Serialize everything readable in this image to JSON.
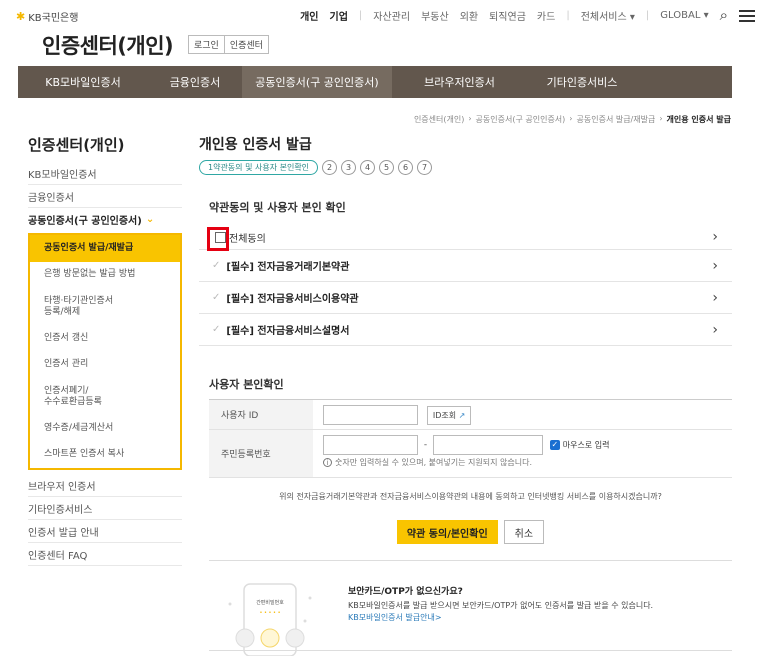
{
  "logo": {
    "mark": "✱",
    "text": "KB국민은행"
  },
  "topnav": {
    "items": [
      "개인",
      "기업",
      "자산관리",
      "부동산",
      "외환",
      "퇴직연금",
      "카드",
      "전체서비스 ▾",
      "GLOBAL ▾"
    ]
  },
  "title": "인증센터(개인)",
  "title_buttons": [
    "로그인",
    "인증센터"
  ],
  "gnb": [
    "KB모바일인증서",
    "금융인증서",
    "공동인증서(구 공인인증서)",
    "브라우저인증서",
    "기타인증서비스"
  ],
  "breadcrumb": [
    "인증센터(개인)",
    "공동인증서(구 공인인증서)",
    "공동인증서 발급/재발급",
    "개인용 인증서 발급"
  ],
  "sidebar": {
    "title": "인증센터(개인)",
    "top_items": [
      "KB모바일인증서",
      "금융인증서",
      "공동인증서(구 공인인증서)"
    ],
    "sub_items": [
      "공동인증서 발급/재발급",
      "은행 방문없는 발급 방법",
      "타행·타기관인증서\n등록/해제",
      "인증서 갱신",
      "인증서 관리",
      "인증서폐기/\n수수료환급등록",
      "영수증/세금계산서",
      "스마트폰 인증서 복사"
    ],
    "bottom_items": [
      "브라우저 인증서",
      "기타인증서비스",
      "인증서 발급 안내",
      "인증센터 FAQ"
    ]
  },
  "main": {
    "title": "개인용 인증서 발급",
    "step1": "1약관동의 및 사용자 본인확인",
    "steps": [
      "2",
      "3",
      "4",
      "5",
      "6",
      "7"
    ],
    "section1": "약관동의 및 사용자 본인 확인",
    "agree_all": "전체동의",
    "terms": [
      "[필수] 전자금융거래기본약관",
      "[필수] 전자금융서비스이용약관",
      "[필수] 전자금융서비스설명서"
    ],
    "section2": "사용자 본인확인",
    "user_id_label": "사용자 ID",
    "id_check_btn": "ID조회",
    "rrn_label": "주민등록번호",
    "rrn_sep": "-",
    "mouse_input": "마우스로 입력",
    "rrn_note": "숫자만 입력하실 수 있으며, 붙여넣기는 지원되지 않습니다.",
    "agree_question": "위의 전자금융거래기본약관과 전자금융서비스이용약관의 내용에 동의하고 인터넷뱅킹 서비스를 이용하시겠습니까?",
    "confirm_btn": "약관 동의/본인확인",
    "cancel_btn": "취소"
  },
  "promo": {
    "title": "보안카드/OTP가 없으신가요?",
    "desc": "KB모바일인증서를 발급 받으시면 보안카드/OTP가 없어도 인증서를 발급 받을 수 있습니다.",
    "link": "KB모바일인증서 발급안내>",
    "phone_label": "간편비밀번호",
    "phone_dots": "• • • • •"
  }
}
